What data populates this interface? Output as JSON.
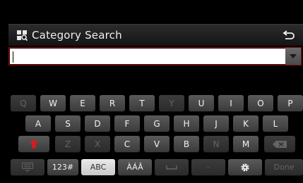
{
  "header": {
    "title": "Category Search",
    "title_icon": "category-search-icon",
    "back_icon": "back-arrow-icon"
  },
  "search": {
    "value": "",
    "dropdown_icon": "dropdown-arrow-icon"
  },
  "keyboard": {
    "row1": [
      {
        "label": "Q",
        "enabled": false
      },
      {
        "label": "W",
        "enabled": true
      },
      {
        "label": "E",
        "enabled": true
      },
      {
        "label": "R",
        "enabled": true
      },
      {
        "label": "T",
        "enabled": true
      },
      {
        "label": "Y",
        "enabled": false
      },
      {
        "label": "U",
        "enabled": true
      },
      {
        "label": "I",
        "enabled": true
      },
      {
        "label": "O",
        "enabled": true
      },
      {
        "label": "P",
        "enabled": true
      }
    ],
    "row2": [
      {
        "label": "A",
        "enabled": true
      },
      {
        "label": "S",
        "enabled": true
      },
      {
        "label": "D",
        "enabled": true
      },
      {
        "label": "F",
        "enabled": true
      },
      {
        "label": "G",
        "enabled": true
      },
      {
        "label": "H",
        "enabled": true
      },
      {
        "label": "J",
        "enabled": true
      },
      {
        "label": "K",
        "enabled": true
      },
      {
        "label": "L",
        "enabled": true
      }
    ],
    "row3": [
      {
        "label": "Z",
        "enabled": false
      },
      {
        "label": "X",
        "enabled": false
      },
      {
        "label": "C",
        "enabled": true
      },
      {
        "label": "V",
        "enabled": true
      },
      {
        "label": "B",
        "enabled": true
      },
      {
        "label": "N",
        "enabled": false
      },
      {
        "label": "M",
        "enabled": true
      }
    ],
    "shift_icon": "shift-arrow-icon",
    "backspace_icon": "backspace-icon",
    "hide_icon": "keyboard-hide-icon",
    "mode_123": "123#",
    "mode_abc": "ABC",
    "mode_accent": "ÀÁÂ",
    "space_icon": "space-icon",
    "dash": "-",
    "settings_icon": "gear-icon",
    "done": "Done",
    "active_mode": "ABC",
    "colors": {
      "shift": "#e01818",
      "key": "#4a4a4a",
      "key_disabled": "#333333",
      "active_key": "#dcdcdc",
      "input_border": "#8a1010"
    }
  }
}
